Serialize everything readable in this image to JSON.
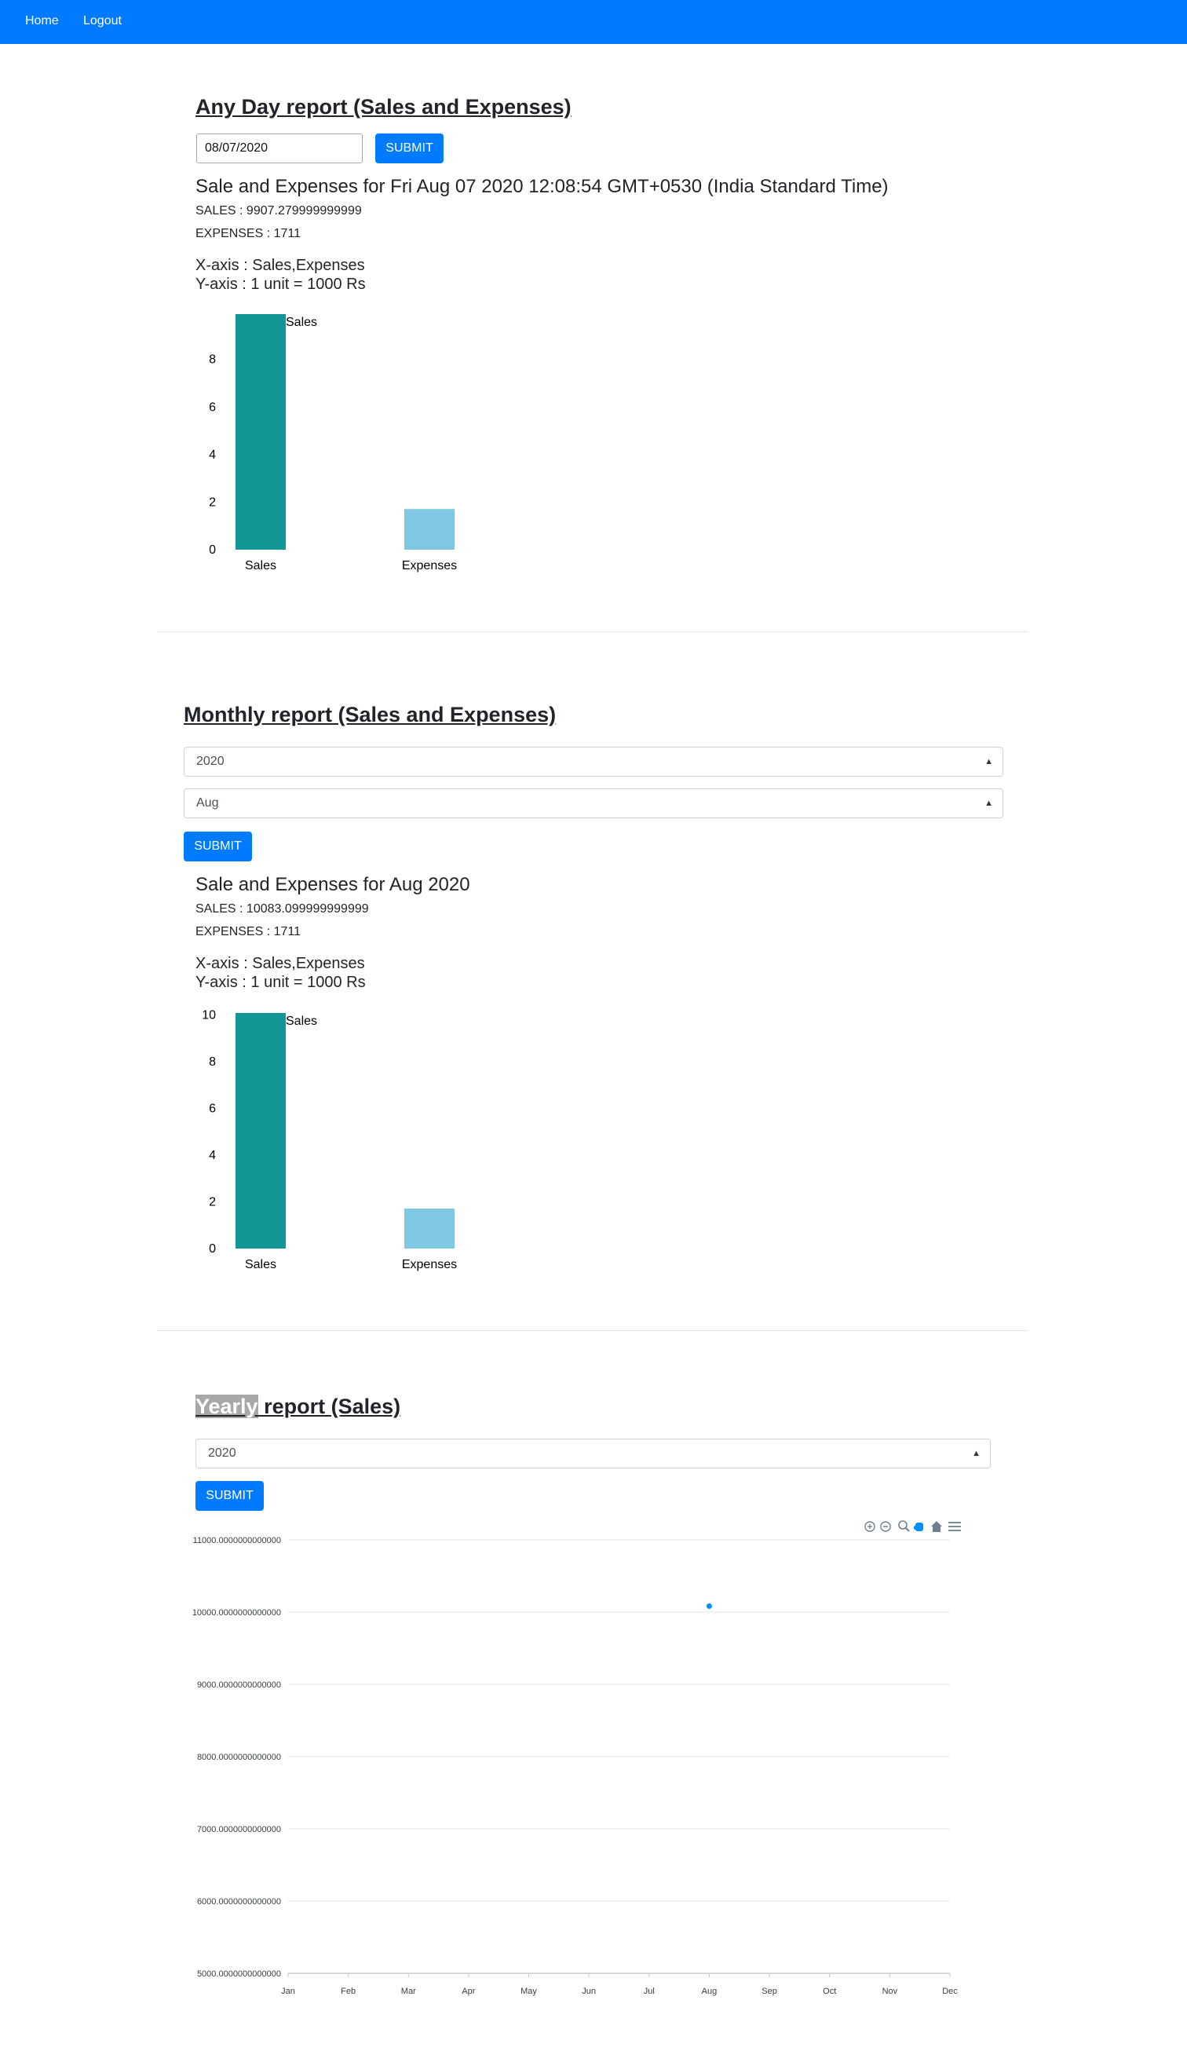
{
  "nav": {
    "home": "Home",
    "logout": "Logout"
  },
  "colors": {
    "navbar": "#007bff",
    "sales_bar": "#139696",
    "expenses_bar": "#7ec8e3",
    "line_point": "#008ffb"
  },
  "day_report": {
    "title": "Any Day report (Sales and Expenses)",
    "date_value": "08/07/2020",
    "submit_label": "SUBMIT",
    "result_title": "Sale and Expenses for Fri Aug 07 2020 12:08:54 GMT+0530 (India Standard Time)",
    "sales_text": "SALES : 9907.279999999999",
    "expenses_text": "EXPENSES : 1711",
    "xaxis_text": "X-axis : Sales,Expenses",
    "yaxis_text": "Y-axis : 1 unit = 1000 Rs"
  },
  "month_report": {
    "title": "Monthly report (Sales and Expenses)",
    "year_value": "2020",
    "month_value": "Aug",
    "submit_label": "SUBMIT",
    "result_title": "Sale and Expenses for Aug 2020",
    "sales_text": "SALES : 10083.099999999999",
    "expenses_text": "EXPENSES : 1711",
    "xaxis_text": "X-axis : Sales,Expenses",
    "yaxis_text": "Y-axis : 1 unit = 1000 Rs"
  },
  "year_report": {
    "title_highlight": "Yearly",
    "title_rest": " report (Sales)",
    "year_value": "2020",
    "submit_label": "SUBMIT",
    "toolbar_icons": [
      "zoom-in-icon",
      "zoom-out-icon",
      "zoom-select-icon",
      "pan-hand-icon",
      "home-icon",
      "menu-icon"
    ]
  },
  "chart_data": [
    {
      "type": "bar",
      "categories": [
        "Sales",
        "Expenses"
      ],
      "values": [
        9.907,
        1.711
      ],
      "bar_label": "Sales",
      "yticks": [
        "0",
        "2",
        "4",
        "6",
        "8"
      ],
      "ylim": [
        0,
        9.907
      ],
      "colors": [
        "#139696",
        "#7ec8e3"
      ]
    },
    {
      "type": "bar",
      "categories": [
        "Sales",
        "Expenses"
      ],
      "values": [
        10.083,
        1.711
      ],
      "bar_label": "Sales",
      "yticks": [
        "0",
        "2",
        "4",
        "6",
        "8",
        "10"
      ],
      "ylim": [
        0,
        10.083
      ],
      "colors": [
        "#139696",
        "#7ec8e3"
      ]
    },
    {
      "type": "scatter",
      "categories": [
        "Jan",
        "Feb",
        "Mar",
        "Apr",
        "May",
        "Jun",
        "Jul",
        "Aug",
        "Sep",
        "Oct",
        "Nov",
        "Dec"
      ],
      "yticks": [
        "11000.0000000000000",
        "10000.0000000000000",
        "9000.0000000000000",
        "8000.0000000000000",
        "7000.0000000000000",
        "6000.0000000000000",
        "5000.0000000000000"
      ],
      "points": [
        {
          "x": "Aug",
          "y": 10083.1
        }
      ],
      "ylim": [
        5000,
        11000
      ],
      "grid": true,
      "color": "#008ffb"
    }
  ]
}
